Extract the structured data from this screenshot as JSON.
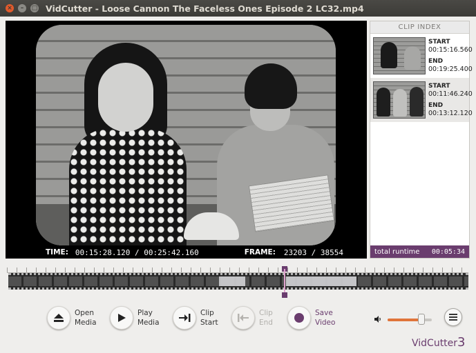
{
  "window": {
    "title": "VidCutter - Loose Cannon The Faceless Ones Episode 2 LC32.mp4",
    "close_glyph": "×",
    "min_glyph": "–",
    "max_glyph": "□"
  },
  "video": {
    "time_label": "TIME:",
    "time_value": "00:15:28.120 / 00:25:42.160",
    "frame_label": "FRAME:",
    "frame_value": "23203 / 38554"
  },
  "clip_index": {
    "header": "CLIP INDEX",
    "start_label": "START",
    "end_label": "END",
    "clips": [
      {
        "start": "00:15:16.560",
        "end": "00:19:25.400"
      },
      {
        "start": "00:11:46.240",
        "end": "00:13:12.120"
      }
    ],
    "runtime_label": "total runtime",
    "runtime_value": "00:05:34"
  },
  "timeline": {
    "position_fraction": 0.602,
    "clip_regions": [
      {
        "start_fraction": 0.458,
        "end_fraction": 0.515
      },
      {
        "start_fraction": 0.603,
        "end_fraction": 0.757
      }
    ]
  },
  "toolbar": {
    "open_media": {
      "line1": "Open",
      "line2": "Media"
    },
    "play_media": {
      "line1": "Play",
      "line2": "Media"
    },
    "clip_start": {
      "line1": "Clip",
      "line2": "Start"
    },
    "clip_end": {
      "line1": "Clip",
      "line2": "End"
    },
    "save_video": {
      "line1": "Save",
      "line2": "Video"
    },
    "volume_fraction": 0.76,
    "icons": {
      "open": "eject-icon",
      "play": "play-icon",
      "clip_start": "clip-start-icon",
      "clip_end": "clip-end-icon",
      "save": "save-dot-icon",
      "volume": "speaker-icon",
      "menu": "hamburger-menu-icon"
    }
  },
  "brand": {
    "name": "VidCutter",
    "version": "3"
  },
  "colors": {
    "accent": "#6a3d6e",
    "volume_fill": "#e0743a",
    "close_button": "#e05a2c",
    "titlebar": "#3c3b37"
  }
}
